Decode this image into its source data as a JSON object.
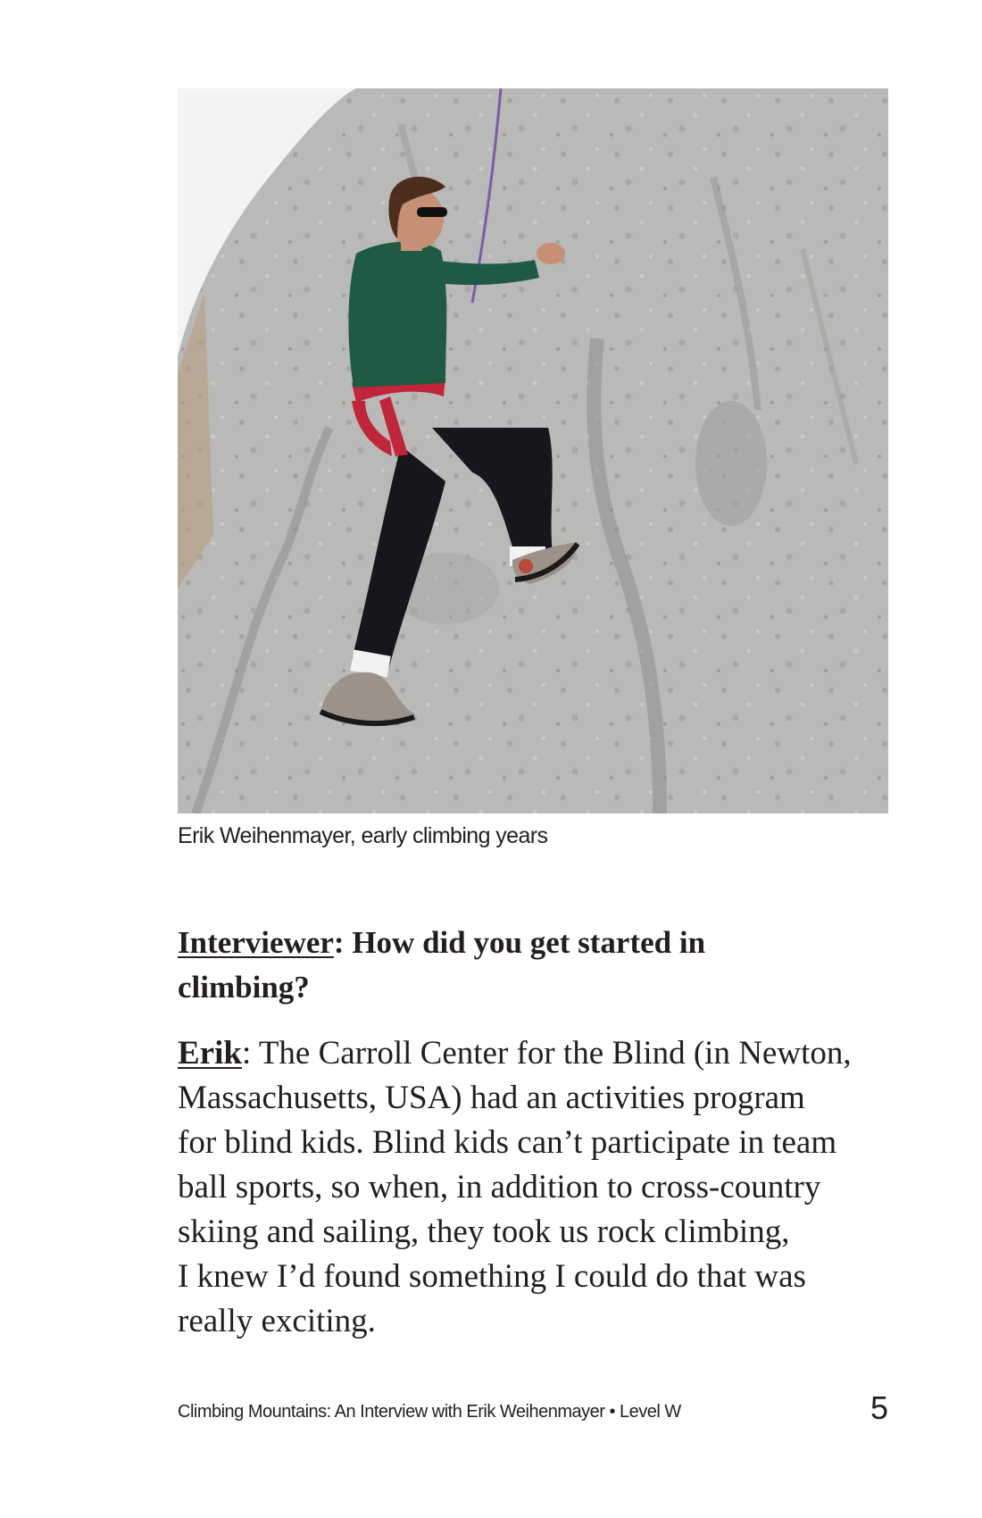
{
  "photo": {
    "subject": "climber-on-rock-face",
    "colors": {
      "rock": "#b7b7b5",
      "rock_shadow": "#8e8e8c",
      "sky": "#f3f3f3",
      "sweater": "#1f5a45",
      "pants": "#16161c",
      "harness": "#c0253a",
      "rope": "#7a5ca8",
      "shoes": "#9c928a"
    }
  },
  "caption": "Erik Weihenmayer, early climbing years",
  "question": {
    "speaker": "Interviewer",
    "separator": ":",
    "text": " How did you get started in",
    "text_line2": "climbing?"
  },
  "answer": {
    "speaker": "Erik",
    "separator": ":",
    "lines": [
      " The Carroll Center for the Blind (in Newton,",
      "Massachusetts, USA) had an activities program",
      "for blind kids. Blind kids can’t participate in team",
      "ball sports, so when, in addition to cross-country",
      "skiing and sailing, they took us rock climbing,",
      "I knew I’d found something I could do that was",
      "really exciting."
    ]
  },
  "footer": {
    "title": "Climbing Mountains: An Interview with Erik Weihenmayer • Level W",
    "page_number": "5"
  }
}
